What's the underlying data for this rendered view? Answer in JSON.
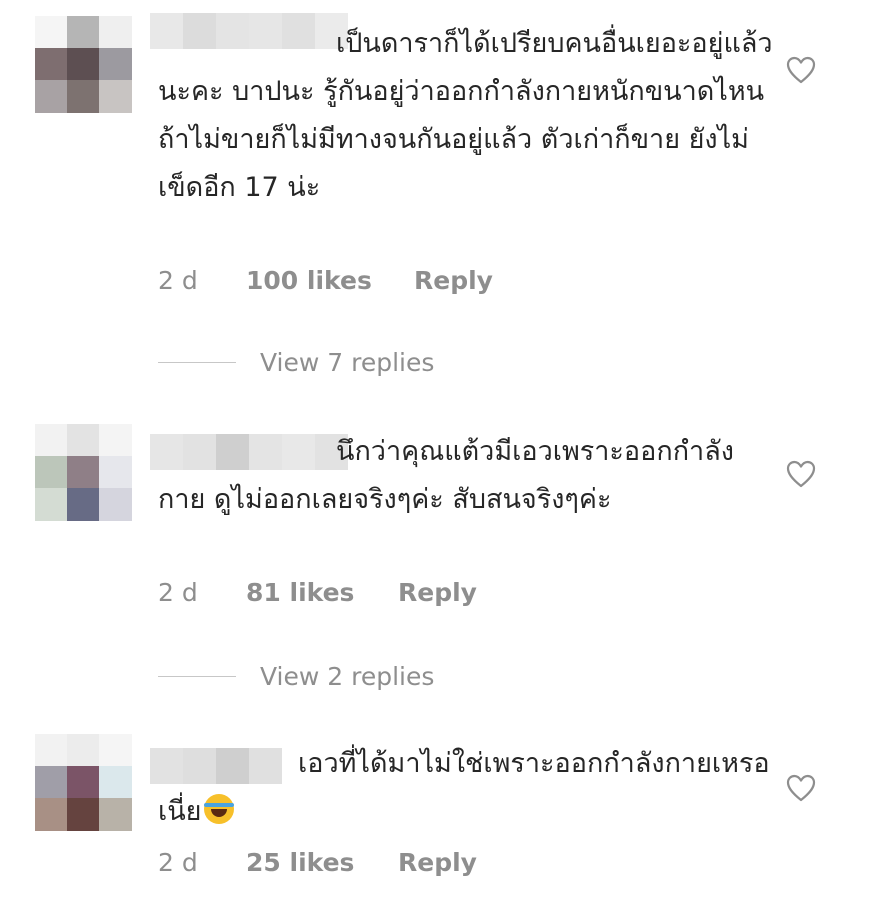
{
  "comments": [
    {
      "text": "เป็นดาราก็ได้เปรียบคนอื่นเยอะอยู่แล้วนะคะ บาปนะ รู้กันอยู่ว่าออกกำลังกายหนักขนาดไหน ถ้าไม่ขายก็ไม่มีทางจนกันอยู่แล้ว ตัวเก่าก็ขาย ยังไม่เข็ดอีก 17 น่ะ",
      "time": "2 d",
      "likes": "100 likes",
      "reply": "Reply",
      "view_replies": "View 7 replies",
      "avatar_colors": [
        "#f5f5f5",
        "#b5b5b5",
        "#efefef",
        "#7e6e70",
        "#5d4f52",
        "#9c9aa0",
        "#a8a2a4",
        "#7d7270",
        "#c8c4c2"
      ],
      "username_colors": [
        "#e8e8e8",
        "#dcdcdc",
        "#e4e4e4",
        "#e6e6e6",
        "#e0e0e0",
        "#ebebeb"
      ]
    },
    {
      "text": "นึกว่าคุณแต้วมีเอวเพราะออกกำลังกาย ดูไม่ออกเลยจริงๆค่ะ สับสนจริงๆค่ะ",
      "time": "2 d",
      "likes": "81 likes",
      "reply": "Reply",
      "view_replies": "View 2 replies",
      "avatar_colors": [
        "#f2f2f2",
        "#e3e3e3",
        "#f4f4f4",
        "#bcc6ba",
        "#8f7f87",
        "#e6e7ec",
        "#d4dcd3",
        "#676b85",
        "#d5d5de"
      ],
      "username_colors": [
        "#e6e6e6",
        "#e2e2e2",
        "#cfcfcf",
        "#e4e4e4",
        "#e8e8e8",
        "#e2e2e2"
      ]
    },
    {
      "text": "เอวที่ได้มาไม่ใช่เพราะออกกำลังกายเหรอเนี่ย",
      "time": "2 d",
      "likes": "25 likes",
      "reply": "Reply",
      "avatar_colors": [
        "#f2f2f2",
        "#ececec",
        "#f5f5f5",
        "#a09ea8",
        "#7b5467",
        "#dbe8ec",
        "#a89085",
        "#65433f",
        "#b8b2a8"
      ],
      "username_colors": [
        "#e2e2e2",
        "#dedede",
        "#cfcfcf",
        "#e0e0e0"
      ]
    }
  ],
  "colors": {
    "text": "#262626",
    "meta": "#8e8e8e",
    "divider": "#c7c7c7"
  },
  "icons": {
    "like": "heart-outline-icon",
    "emoji": "tears-of-joy-emoji"
  }
}
